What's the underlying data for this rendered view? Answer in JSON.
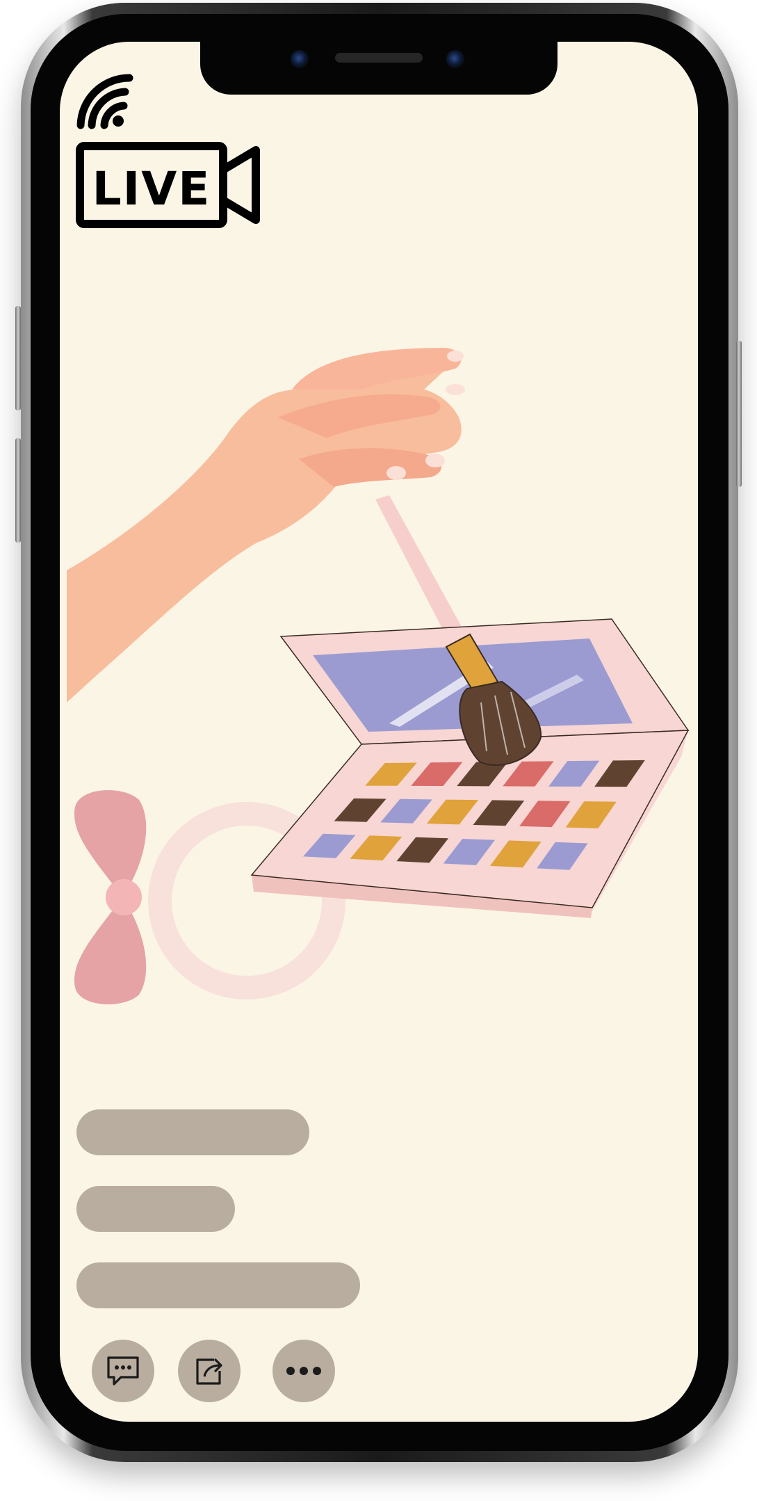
{
  "live_badge": {
    "label": "LIVE",
    "icon": "live-video-icon"
  },
  "placeholders": {
    "lines": [
      "",
      "",
      ""
    ]
  },
  "actions": [
    {
      "icon": "comment-icon"
    },
    {
      "icon": "share-icon"
    },
    {
      "icon": "more-icon"
    }
  ],
  "colors": {
    "screen_background": "#fbf5e6",
    "placeholder": "#b8ad9e",
    "palette_case": "#f7d6d3",
    "mirror": "#9b9bd2",
    "bow": "#e5a3a6",
    "brush_handle": "#e0a23a",
    "brush_bristles": "#5f4330"
  },
  "palette": {
    "rows": [
      [
        "#e0a23a",
        "#d96b68",
        "#5f4330",
        "#d96b68",
        "#9b9bd2",
        "#5f4330"
      ],
      [
        "#5f4330",
        "#9b9bd2",
        "#e0a23a",
        "#5f4330",
        "#d96b68",
        "#e0a23a"
      ],
      [
        "#9b9bd2",
        "#e0a23a",
        "#5f4330",
        "#9b9bd2",
        "#e0a23a",
        "#9b9bd2"
      ]
    ]
  }
}
